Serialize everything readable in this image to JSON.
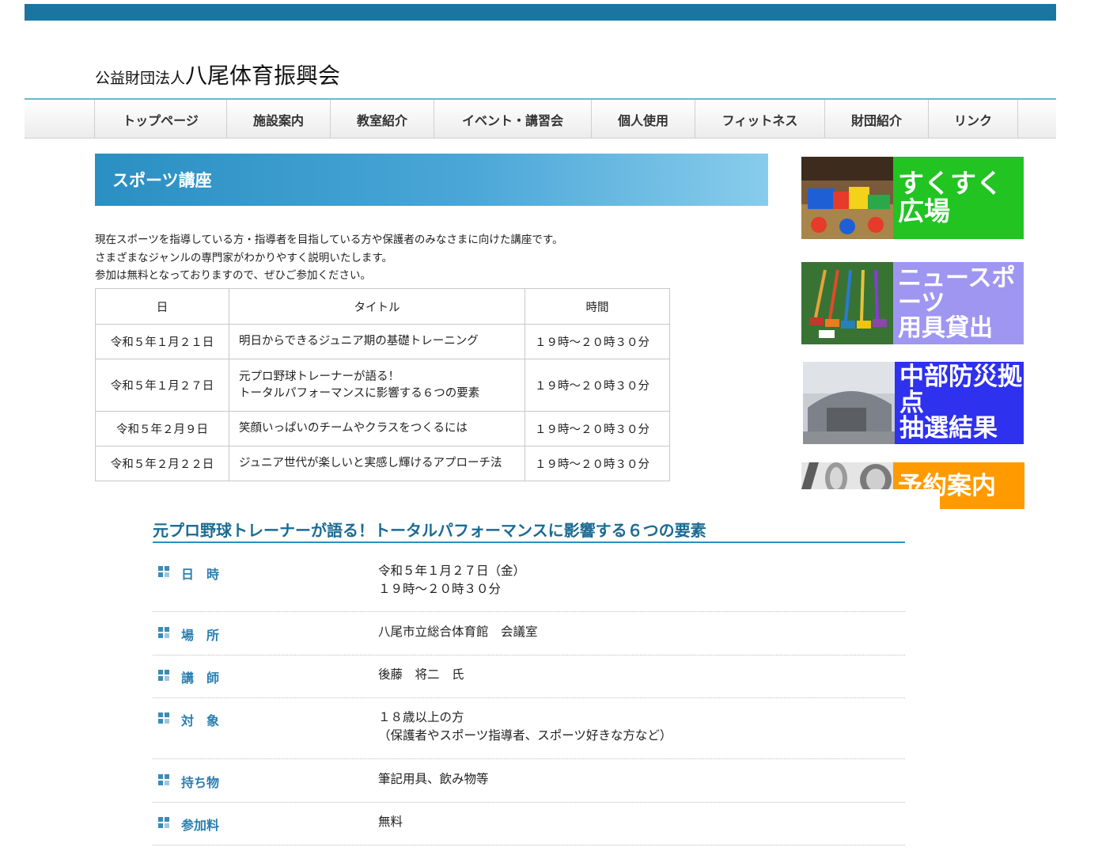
{
  "header": {
    "org_prefix": "公益財団法人",
    "org_name": "八尾体育振興会"
  },
  "nav": {
    "items": [
      {
        "label": "トップページ"
      },
      {
        "label": "施設案内"
      },
      {
        "label": "教室紹介"
      },
      {
        "label": "イベント・講習会"
      },
      {
        "label": "個人使用"
      },
      {
        "label": "フィットネス"
      },
      {
        "label": "財団紹介"
      },
      {
        "label": "リンク"
      }
    ]
  },
  "banner": {
    "title": "スポーツ講座"
  },
  "intro": {
    "lines": [
      "現在スポーツを指導している方・指導者を目指している方や保護者のみなさまに向けた講座です。",
      "さまざまなジャンルの専門家がわかりやすく説明いたします。",
      "参加は無料となっておりますので、ぜひご参加ください。"
    ]
  },
  "schedule": {
    "headers": {
      "date": "日",
      "title": "タイトル",
      "time": "時間"
    },
    "rows": [
      {
        "date": "令和５年１月２１日",
        "title_line1": "明日からできるジュニア期の基礎トレーニング",
        "title_line2": "",
        "time": "１９時～２０時３０分"
      },
      {
        "date": "令和５年１月２７日",
        "title_line1": "元プロ野球トレーナーが語る！",
        "title_line2": "トータルパフォーマンスに影響する６つの要素",
        "time": "１９時～２０時３０分"
      },
      {
        "date": "令和５年２月９日",
        "title_line1": "笑顔いっぱいのチームやクラスをつくるには",
        "title_line2": "",
        "time": "１９時～２０時３０分"
      },
      {
        "date": "令和５年２月２２日",
        "title_line1": "ジュニア世代が楽しいと実感し輝けるアプローチ法",
        "title_line2": "",
        "time": "１９時～２０時３０分"
      }
    ]
  },
  "sidebar": {
    "banners": [
      {
        "line1": "すくすく広場",
        "line2": "",
        "bg": "#21c421",
        "fg": "#ffffff"
      },
      {
        "line1": "ニュースポーツ",
        "line2": "用具貸出",
        "bg": "#9f96f2",
        "fg": "#ffffff"
      },
      {
        "line1": "中部防災拠点",
        "line2": "抽選結果",
        "bg": "#2e31ee",
        "fg": "#ffffff"
      },
      {
        "line1": "予約案内",
        "line2": "",
        "bg": "#ff9a00",
        "fg": "#ffffff"
      }
    ]
  },
  "detail": {
    "heading": "元プロ野球トレーナーが語る！トータルパフォーマンスに影響する６つの要素",
    "rows": [
      {
        "label": "日　時",
        "line1": "令和５年１月２７日（金）",
        "line2": "１９時～２０時３０分"
      },
      {
        "label": "場　所",
        "line1": "八尾市立総合体育館　会議室",
        "line2": ""
      },
      {
        "label": "講　師",
        "line1": "後藤　将二　氏",
        "line2": ""
      },
      {
        "label": "対　象",
        "line1": "１８歳以上の方",
        "line2": "（保護者やスポーツ指導者、スポーツ好きな方など）"
      },
      {
        "label": "持ち物",
        "line1": "筆記用具、飲み物等",
        "line2": ""
      },
      {
        "label": "参加料",
        "line1": "無料",
        "line2": ""
      }
    ]
  }
}
